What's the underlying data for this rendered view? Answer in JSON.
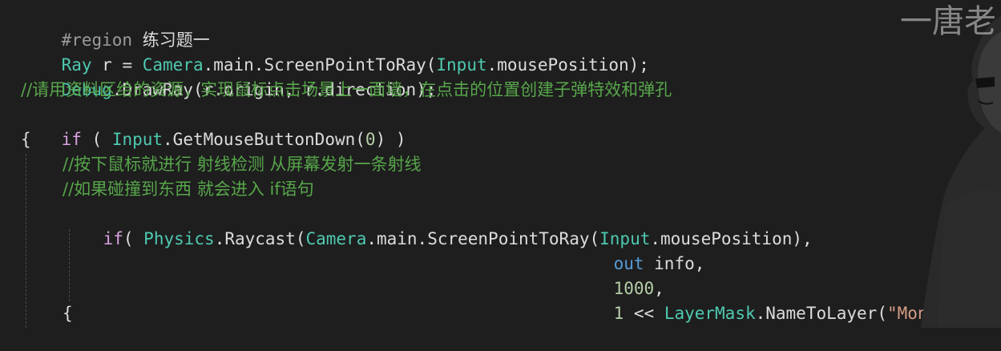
{
  "code": {
    "line1": {
      "directive": "#region",
      "name": "练习题一"
    },
    "line2": {
      "type": "Ray",
      "var": " r = ",
      "class": "Camera",
      "rest": ".main.ScreenPointToRay(",
      "input": "Input",
      "tail": ".mousePosition);"
    },
    "line3": {
      "class": "Debug",
      "rest": ".DrawRay(r.origin, r.direction);"
    },
    "line4": {
      "comment": "//请用资料区给的资源，实现鼠标点击场景上一面墙，在点击的位置创建子弹特效和弹孔"
    },
    "line5": {
      "kw": "if",
      "open": " ( ",
      "class": "Input",
      "rest": ".GetMouseButtonDown(",
      "num": "0",
      "close": ") )"
    },
    "line6": {
      "brace": "{"
    },
    "line7": {
      "comment": "//按下鼠标就进行 射线检测 从屏幕发射一条射线"
    },
    "line8": {
      "comment": "//如果碰撞到东西 就会进入 if语句"
    },
    "line9": {
      "kw": "if",
      "open": "( ",
      "class": "Physics",
      "rest": ".Raycast(",
      "class2": "Camera",
      "rest2": ".main.ScreenPointToRay(",
      "class3": "Input",
      "tail": ".mousePosition),"
    },
    "line10": {
      "kw": "out",
      "rest": " info,"
    },
    "line11": {
      "num": "1000",
      "rest": ","
    },
    "line12": {
      "num": "1",
      "op": " << ",
      "class": "LayerMask",
      "rest": ".NameToLayer(",
      "str": "\"Monster\"",
      "close": ")))"
    },
    "line13": {
      "brace": "{"
    }
  },
  "watermark": "一唐老"
}
